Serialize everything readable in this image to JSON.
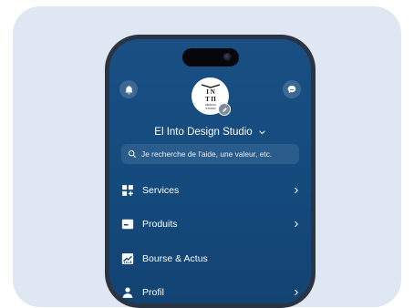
{
  "header": {
    "studio_name": "El Into Design Studio"
  },
  "search": {
    "placeholder": "Je recherche de l'aide, une valeur, etc."
  },
  "menu": {
    "items": [
      {
        "label": "Services",
        "icon": "grid-plus-icon",
        "has_chevron": true
      },
      {
        "label": "Produits",
        "icon": "card-icon",
        "has_chevron": true
      },
      {
        "label": "Bourse & Actus",
        "icon": "chart-icon",
        "has_chevron": false
      },
      {
        "label": "Profil",
        "icon": "person-icon",
        "has_chevron": true
      }
    ]
  },
  "logo": {
    "lines": [
      "I N",
      "T Π",
      "DESIGN",
      "STUDIO"
    ]
  },
  "colors": {
    "background_card": "#dfe7f2",
    "screen": "#1a4f84",
    "search_field": "#2a5d8c",
    "round_button": "#3d6894"
  }
}
